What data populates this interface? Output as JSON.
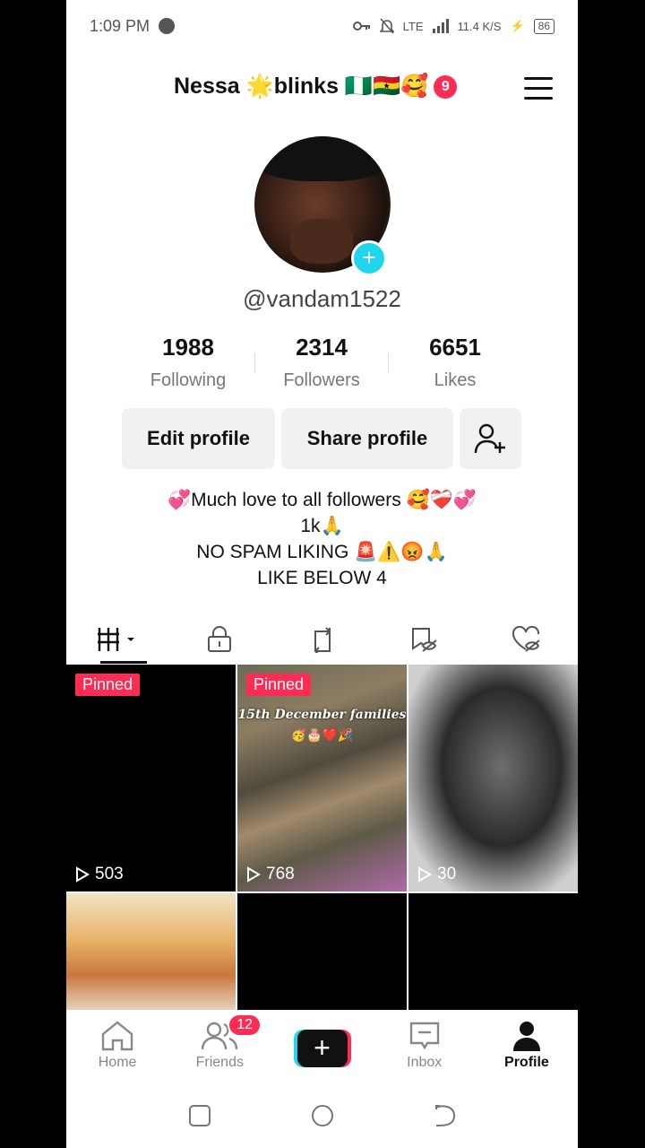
{
  "status": {
    "time": "1:09 PM",
    "network": "LTE",
    "speed": "11.4 K/S",
    "battery": "86"
  },
  "header": {
    "title": "Nessa 🌟blinks 🇳🇬🇬🇭🥰",
    "badge_count": "9"
  },
  "profile": {
    "handle": "@vandam1522",
    "stats": [
      {
        "value": "1988",
        "label": "Following"
      },
      {
        "value": "2314",
        "label": "Followers"
      },
      {
        "value": "6651",
        "label": "Likes"
      }
    ],
    "edit_label": "Edit profile",
    "share_label": "Share profile",
    "bio": [
      "💞Much love to all followers 🥰❤️‍🩹💞",
      "1k🙏",
      "NO SPAM LIKING 🚨⚠️😡🙏",
      "LIKE BELOW 4"
    ]
  },
  "videos": [
    {
      "pinned": "Pinned",
      "views": "503"
    },
    {
      "pinned": "Pinned",
      "views": "768",
      "caption": "15th December families",
      "caption_emoji": "🥳🎂❤️🎉"
    },
    {
      "views": "30"
    }
  ],
  "bottom_nav": {
    "home": "Home",
    "friends": "Friends",
    "friends_badge": "12",
    "add": "+",
    "inbox": "Inbox",
    "profile": "Profile"
  },
  "colors": {
    "accent": "#fe2c55",
    "cyan": "#20d5ec"
  }
}
